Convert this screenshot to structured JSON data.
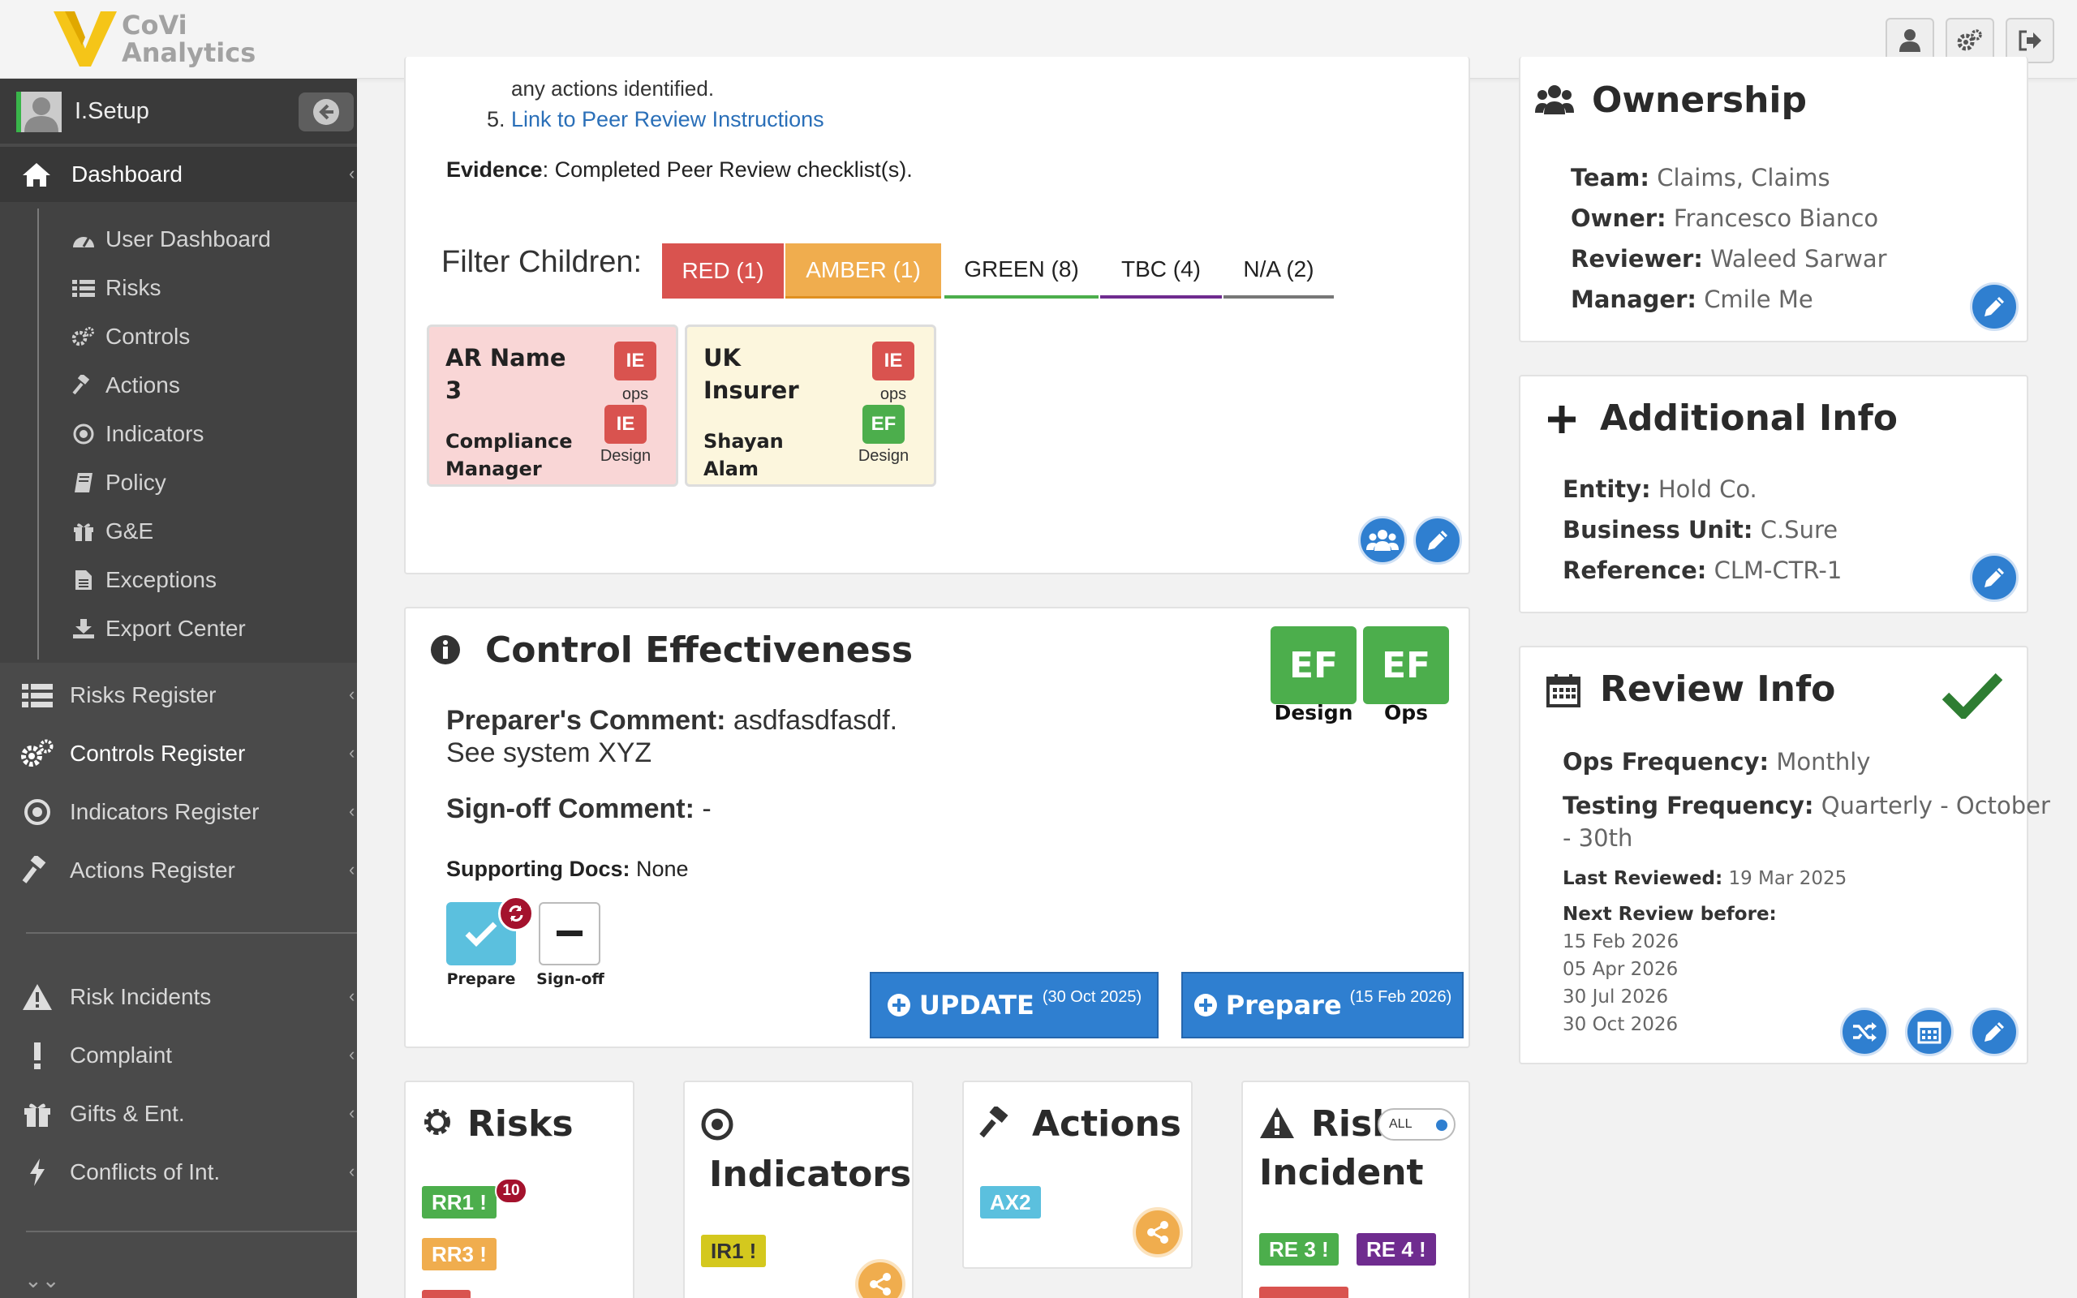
{
  "app": {
    "logo_line1": "CoVi",
    "logo_line2": "Analytics"
  },
  "topbar": {
    "icons": [
      "user-icon",
      "settings-icon",
      "logout-icon"
    ]
  },
  "sidebar": {
    "user_name": "I.Setup",
    "dashboard_label": "Dashboard",
    "dashboard_items": [
      {
        "label": "User Dashboard",
        "icon": "dashboard-gauge-icon"
      },
      {
        "label": "Risks",
        "icon": "list-icon"
      },
      {
        "label": "Controls",
        "icon": "cogs-icon"
      },
      {
        "label": "Actions",
        "icon": "gavel-icon"
      },
      {
        "label": "Indicators",
        "icon": "dot-circle-icon"
      },
      {
        "label": "Policy",
        "icon": "book-icon"
      },
      {
        "label": "G&E",
        "icon": "gift-icon"
      },
      {
        "label": "Exceptions",
        "icon": "file-icon"
      },
      {
        "label": "Export Center",
        "icon": "download-icon"
      }
    ],
    "registers": [
      {
        "label": "Risks Register",
        "icon": "list-icon"
      },
      {
        "label": "Controls Register",
        "icon": "cogs-icon"
      },
      {
        "label": "Indicators Register",
        "icon": "dot-circle-icon"
      },
      {
        "label": "Actions Register",
        "icon": "gavel-icon"
      }
    ],
    "incidents": [
      {
        "label": "Risk Incidents",
        "icon": "warning-icon"
      },
      {
        "label": "Complaint",
        "icon": "exclamation-icon"
      },
      {
        "label": "Gifts & Ent.",
        "icon": "gift-icon"
      },
      {
        "label": "Conflicts of Int.",
        "icon": "bolt-icon"
      }
    ]
  },
  "instructions": {
    "line_partial": "any actions identified.",
    "item5_number": "5.",
    "item5_link": "Link to Peer Review Instructions",
    "evidence_label": "Evidence",
    "evidence_text": ": Completed Peer Review checklist(s)."
  },
  "filter": {
    "label": "Filter Children:",
    "tabs": [
      {
        "label": "RED (1)",
        "color": "#d9534f"
      },
      {
        "label": "AMBER (1)",
        "color": "#f0ad4e"
      },
      {
        "label": "GREEN (8)",
        "color": "#4cae4c"
      },
      {
        "label": "TBC (4)",
        "color": "#6f2c8f"
      },
      {
        "label": "N/A (2)",
        "color": "#777777"
      }
    ]
  },
  "children": [
    {
      "name_line1": "AR Name",
      "name_line2": "3",
      "person_line1": "Compliance",
      "person_line2": "Manager",
      "chip_top": "IE",
      "chip_top_cap": "ops",
      "chip_bottom": "IE",
      "chip_bottom_cap": "Design"
    },
    {
      "name_line1": "UK",
      "name_line2": "Insurer",
      "person_line1": "Shayan",
      "person_line2": "Alam",
      "chip_top": "IE",
      "chip_top_cap": "ops",
      "chip_bottom": "EF",
      "chip_bottom_cap": "Design"
    }
  ],
  "effectiveness": {
    "title": "Control Effectiveness",
    "design_badge": "EF",
    "design_label": "Design",
    "ops_badge": "EF",
    "ops_label": "Ops",
    "preparer_label": "Preparer's Comment:",
    "preparer_text": " asdfasdfasdf.",
    "preparer_text2": "See system XYZ",
    "signoff_label": "Sign-off Comment:",
    "signoff_text": " -",
    "docs_label": "Supporting Docs:",
    "docs_text": " None",
    "prepare_caption": "Prepare",
    "signoff_caption": "Sign-off",
    "update_label": "UPDATE",
    "update_date": "(30 Oct 2025)",
    "prepare_label": "Prepare",
    "prepare_date": "(15 Feb 2026)"
  },
  "ownership": {
    "title": "Ownership",
    "team_label": "Team:",
    "team": "Claims, Claims",
    "owner_label": "Owner:",
    "owner": "Francesco Bianco",
    "reviewer_label": "Reviewer:",
    "reviewer": "Waleed Sarwar",
    "manager_label": "Manager:",
    "manager": "Cmile Me"
  },
  "additional": {
    "title": "Additional Info",
    "entity_label": "Entity:",
    "entity": "Hold Co.",
    "bu_label": "Business Unit:",
    "bu": "C.Sure",
    "ref_label": "Reference:",
    "ref": "CLM-CTR-1"
  },
  "review": {
    "title": "Review Info",
    "ops_freq_label": "Ops Frequency:",
    "ops_freq": "Monthly",
    "test_freq_label": "Testing Frequency:",
    "test_freq_1": "Quarterly - October",
    "test_freq_2": "- 30th",
    "last_label": "Last Reviewed:",
    "last": "19 Mar 2025",
    "next_label": "Next Review before:",
    "next_dates": [
      "15 Feb 2026",
      "05 Apr 2026",
      "30 Jul 2026",
      "30 Oct 2026"
    ]
  },
  "bottom": {
    "risks": {
      "title": "Risks",
      "pills": [
        {
          "label": "RR1 !",
          "color": "#4cae4c",
          "badge": "10"
        },
        {
          "label": "RR3 !",
          "color": "#f0ad4e"
        }
      ]
    },
    "indicators": {
      "title": "Indicators",
      "pills": [
        {
          "label": "IR1 !",
          "color": "#d4c81e"
        }
      ]
    },
    "actions": {
      "title": "Actions",
      "pills": [
        {
          "label": "AX2",
          "color": "#5bc0de"
        }
      ]
    },
    "incident": {
      "title_line1": "Risk",
      "title_line2": "Incident",
      "toggle_label": "ALL",
      "pills": [
        {
          "label": "RE 3 !",
          "color": "#4cae4c"
        },
        {
          "label": "RE 4 !",
          "color": "#6f2c8f"
        }
      ]
    }
  }
}
